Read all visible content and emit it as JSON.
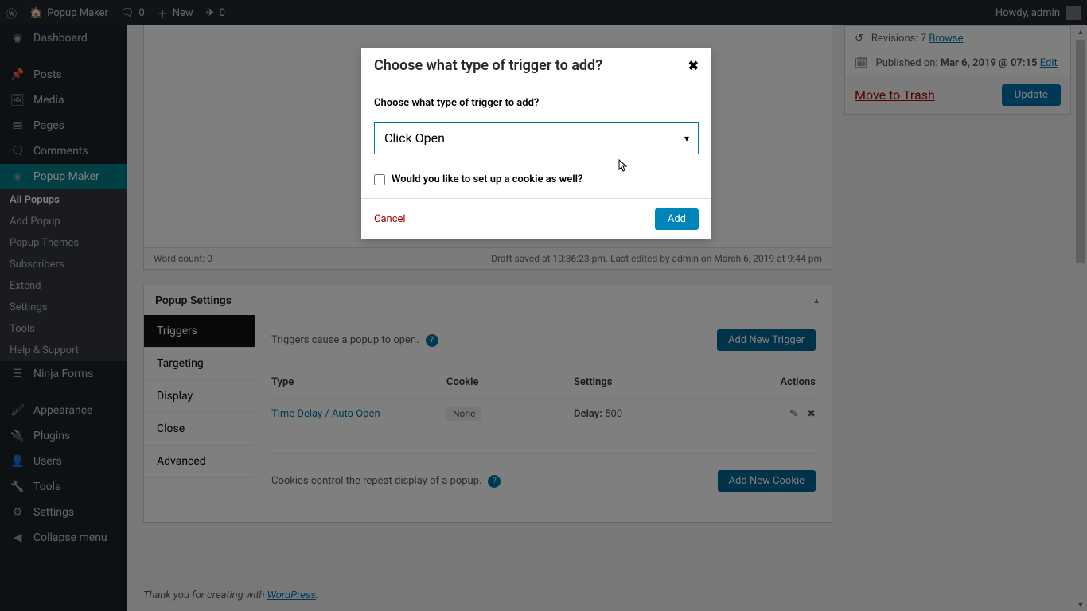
{
  "adminbar": {
    "site": "Popup Maker",
    "comments": "0",
    "new": "New",
    "flights": "0",
    "greeting": "Howdy, admin"
  },
  "sidebar": {
    "dashboard": "Dashboard",
    "posts": "Posts",
    "media": "Media",
    "pages": "Pages",
    "comments": "Comments",
    "popup_maker": "Popup Maker",
    "sub": {
      "all": "All Popups",
      "add": "Add Popup",
      "themes": "Popup Themes",
      "subs": "Subscribers",
      "extend": "Extend",
      "settings": "Settings",
      "tools": "Tools",
      "help": "Help & Support"
    },
    "ninja": "Ninja Forms",
    "appearance": "Appearance",
    "plugins": "Plugins",
    "users": "Users",
    "tools": "Tools",
    "settings": "Settings",
    "collapse": "Collapse menu"
  },
  "editor": {
    "wordcount": "Word count: 0",
    "draft_status": "Draft saved at 10:36:23 pm. Last edited by admin on March 6, 2019 at 9:44 pm"
  },
  "popsettings": {
    "title": "Popup Settings",
    "tabs": {
      "triggers": "Triggers",
      "targeting": "Targeting",
      "display": "Display",
      "close": "Close",
      "advanced": "Advanced"
    },
    "triggers_text": "Triggers cause a popup to open.",
    "add_trigger_btn": "Add New Trigger",
    "cols": {
      "type": "Type",
      "cookie": "Cookie",
      "settings": "Settings",
      "actions": "Actions"
    },
    "row": {
      "type": "Time Delay / Auto Open",
      "cookie": "None",
      "setting_label": "Delay:",
      "setting_val": "500"
    },
    "cookies_text": "Cookies control the repeat display of a popup.",
    "add_cookie_btn": "Add New Cookie"
  },
  "publish": {
    "revisions_label": "Revisions:",
    "revisions_count": "7",
    "browse": "Browse",
    "published_label": "Published on:",
    "published_val": "Mar 6, 2019 @ 07:15",
    "edit": "Edit",
    "trash": "Move to Trash",
    "update": "Update"
  },
  "modal": {
    "title": "Choose what type of trigger to add?",
    "label": "Choose what type of trigger to add?",
    "selected": "Click Open",
    "cookie_q": "Would you like to set up a cookie as well?",
    "cancel": "Cancel",
    "add": "Add"
  },
  "footer": {
    "thanks": "Thank you for creating with ",
    "wp": "WordPress"
  }
}
